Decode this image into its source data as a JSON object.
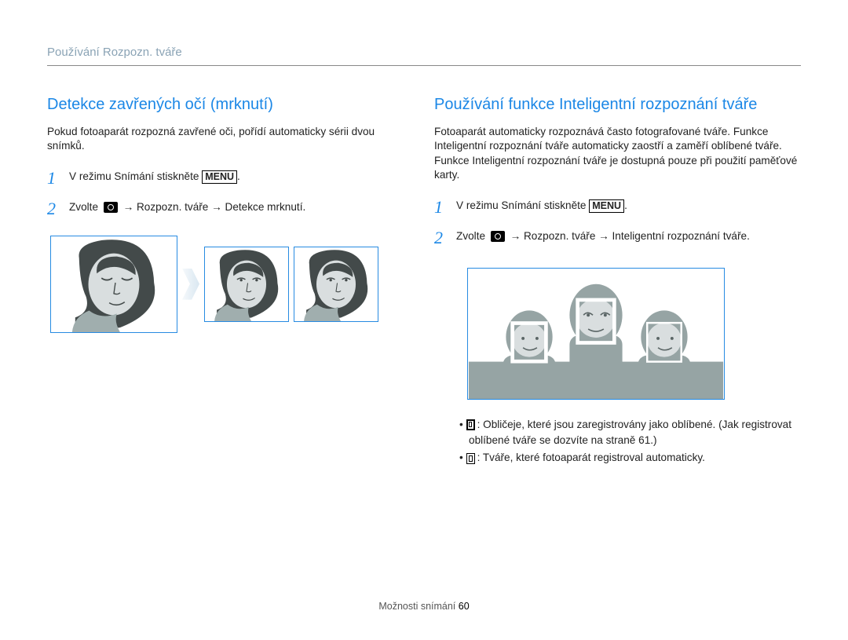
{
  "header": {
    "title": "Používání Rozpozn. tváře"
  },
  "left": {
    "heading": "Detekce zavřených očí (mrknutí)",
    "intro": "Pokud fotoaparát rozpozná zavřené oči, pořídí automaticky sérii dvou snímků.",
    "step1": {
      "num": "1",
      "t1": "V režimu Snímání stiskněte ",
      "menu": "MENU",
      "t2": "."
    },
    "step2": {
      "num": "2",
      "t1": "Zvolte ",
      "mid": " → Rozpozn. tváře → Detekce mrknutí",
      "t2": "."
    }
  },
  "right": {
    "heading": "Používání funkce Inteligentní rozpoznání tváře",
    "intro": "Fotoaparát automaticky rozpoznává často fotografované tváře. Funkce Inteligentní rozpoznání tváře automaticky zaostří a zaměří oblíbené tváře. Funkce Inteligentní rozpoznání tváře je dostupná pouze při použití paměťové karty.",
    "step1": {
      "num": "1",
      "t1": "V režimu Snímání stiskněte ",
      "menu": "MENU",
      "t2": "."
    },
    "step2": {
      "num": "2",
      "t1": "Zvolte ",
      "mid": " → Rozpozn. tváře → Inteligentní rozpoznání tváře",
      "t2": "."
    },
    "b1": ": Obličeje, které jsou zaregistrovány jako oblíbené. (Jak registrovat oblíbené tváře se dozvíte na straně 61.)",
    "b2": ": Tváře, které fotoaparát registroval automaticky."
  },
  "footer": {
    "section": "Možnosti snímání ",
    "page": "60"
  }
}
